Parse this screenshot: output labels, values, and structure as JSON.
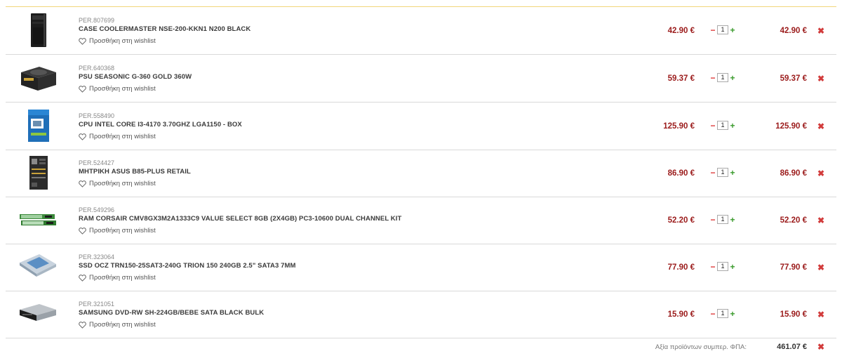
{
  "cart": {
    "wishlist_label": "Προσθήκη στη wishlist",
    "items": [
      {
        "code": "PER.807699",
        "name": "CASE COOLERMASTER NSE-200-KKN1 N200 BLACK",
        "price": "42.90 €",
        "qty": "1",
        "total": "42.90 €",
        "image_icon": "pc-case"
      },
      {
        "code": "PER.640368",
        "name": "PSU SEASONIC G-360 GOLD 360W",
        "price": "59.37 €",
        "qty": "1",
        "total": "59.37 €",
        "image_icon": "power-supply"
      },
      {
        "code": "PER.558490",
        "name": "CPU INTEL CORE I3-4170 3.70GHZ LGA1150 - BOX",
        "price": "125.90 €",
        "qty": "1",
        "total": "125.90 €",
        "image_icon": "cpu-box"
      },
      {
        "code": "PER.524427",
        "name": "ΜΗΤΡΙΚΗ ASUS B85-PLUS RETAIL",
        "price": "86.90 €",
        "qty": "1",
        "total": "86.90 €",
        "image_icon": "motherboard"
      },
      {
        "code": "PER.549296",
        "name": "RAM CORSAIR CMV8GX3M2A1333C9 VALUE SELECT 8GB (2X4GB) PC3-10600 DUAL CHANNEL KIT",
        "price": "52.20 €",
        "qty": "1",
        "total": "52.20 €",
        "image_icon": "ram-modules"
      },
      {
        "code": "PER.323064",
        "name": "SSD OCZ TRN150-25SAT3-240G TRION 150 240GB 2.5\" SATA3 7MM",
        "price": "77.90 €",
        "qty": "1",
        "total": "77.90 €",
        "image_icon": "ssd-drive"
      },
      {
        "code": "PER.321051",
        "name": "SAMSUNG DVD-RW SH-224GB/BEBE SATA BLACK BULK",
        "price": "15.90 €",
        "qty": "1",
        "total": "15.90 €",
        "image_icon": "dvd-drive"
      }
    ],
    "minus_glyph": "−",
    "plus_glyph": "+",
    "remove_glyph": "✖",
    "summary": {
      "label": "Αξία προϊόντων συμπερ. ΦΠΑ:",
      "value": "461.07 €"
    }
  },
  "colors": {
    "price": "#9b1b1b",
    "remove": "#d23c3c",
    "plus": "#3a9a2c",
    "minus": "#d33333",
    "accent_line": "#f1d67a"
  }
}
